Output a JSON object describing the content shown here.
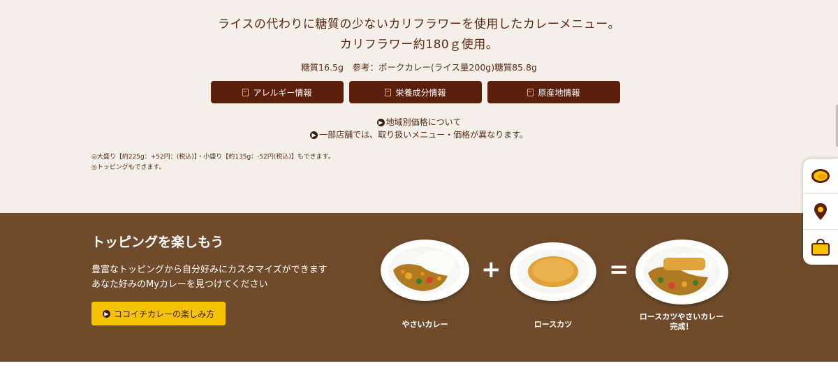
{
  "description": {
    "line1": "ライスの代わりに糖質の少ないカリフラワーを使用したカレーメニュー。",
    "line2": "カリフラワー約180ｇ使用。",
    "carb_info": "糖質16.5g　参考：ポークカレー(ライス量200g)糖質85.8g"
  },
  "info_buttons": [
    {
      "label": "アレルギー情報"
    },
    {
      "label": "栄養成分情報"
    },
    {
      "label": "原産地情報"
    }
  ],
  "notes": {
    "regional_price": "地域別価格について",
    "store_notice": "一部店舗では、取り扱いメニュー・価格が異なります。"
  },
  "small_notes": [
    "◎大盛り【約225g：+52円：(税込)】・小盛り【約135g：-52円(税込)】もできます。",
    "◎トッピングもできます。"
  ],
  "side_nav": {
    "icons": [
      "curry-bowl-icon",
      "map-pin-icon",
      "shopping-bag-icon"
    ]
  },
  "topping": {
    "title": "トッピングを楽しもう",
    "text1": "豊富なトッピングから自分好みにカスタマイズができます",
    "text2": "あなた好みのMyカレーを見つけてください",
    "button_label": "ココイチカレーの楽しみ方",
    "dishes": [
      {
        "label": "やさいカレー"
      },
      {
        "label": "ロースカツ"
      },
      {
        "label": "ロースカツやさいカレー\n完成！"
      }
    ],
    "plus": "+",
    "equals": "="
  },
  "colors": {
    "background": "#f4efe8",
    "brown_button": "#5b1f0c",
    "band": "#6f4b2b",
    "yellow": "#f5c200"
  }
}
